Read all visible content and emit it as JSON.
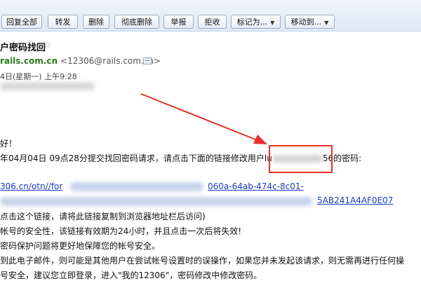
{
  "toolbar": {
    "reply_all": "回复全部",
    "forward": "转发",
    "delete": "删除",
    "perm_delete": "彻底删除",
    "report": "举报",
    "reject": "拒收",
    "mark_as": "标记为...",
    "move_to": "移动到..."
  },
  "email": {
    "subject": "户密码找回",
    "star": "☆",
    "sender_name": "rails.com.cn",
    "sender_address": "<12306@rails.com.cn>",
    "date": "4日(星期一) 上午9:28"
  },
  "body": {
    "greeting": "好！",
    "line1": "年04月04日 09点28分提交找回密码请求，请点击下面的链接修改用户lu",
    "line1_tail": "56的密码:",
    "link1": "306.cn/otn//for",
    "link1_tail": "060a-64ab-474c-8c01-",
    "link2_tail": "5AB241A4AF0E07",
    "line3": "点击这个链接，请将此链接复制到浏览器地址栏后访问)",
    "line4": "帐号的安全性，该链接有效期为24小时，并且点击一次后将失效!",
    "line5": "密码保护问题将更好地保障您的帐号安全。",
    "line6": "到此电子邮件，则可能是其他用户在尝试帐号设置时的误操作，如果您并未发起该请求，则无需再进行任何操",
    "line7": "号安全，建议您立即登录，进入\"我的12306\"，密码修改中修改密码。"
  },
  "colors": {
    "annotation_red": "#e8302a",
    "link_blue": "#1a3cc8",
    "sender_green": "#2a7a1c"
  }
}
